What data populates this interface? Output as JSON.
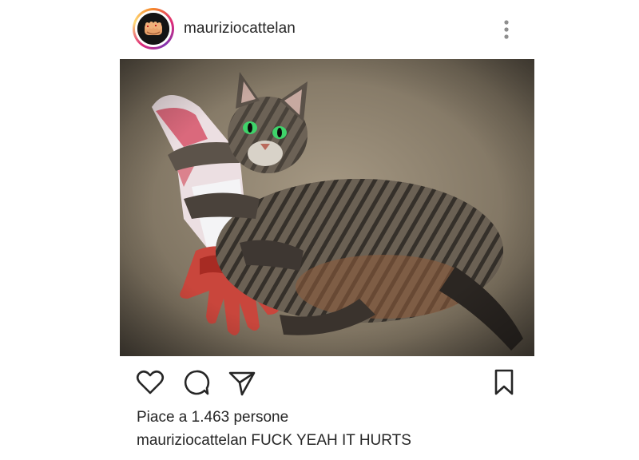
{
  "post": {
    "username": "mauriziocattelan",
    "likes_text": "Piace a 1.463 persone",
    "caption_user": "mauriziocattelan",
    "caption_text": "FUCK YEAH IT HURTS"
  },
  "icons": {
    "more": "more-vertical-icon",
    "like": "heart-icon",
    "comment": "comment-bubble-icon",
    "share": "paper-plane-icon",
    "save": "bookmark-icon"
  },
  "colors": {
    "text": "#262626",
    "story_ring_start": "#f58529",
    "story_ring_end": "#dd2a7b",
    "icon_stroke": "#262626",
    "more_dots": "#8e8e8e"
  },
  "image": {
    "subject": "tabby cat lying on carpet hugging a severed bloody mannequin arm"
  }
}
